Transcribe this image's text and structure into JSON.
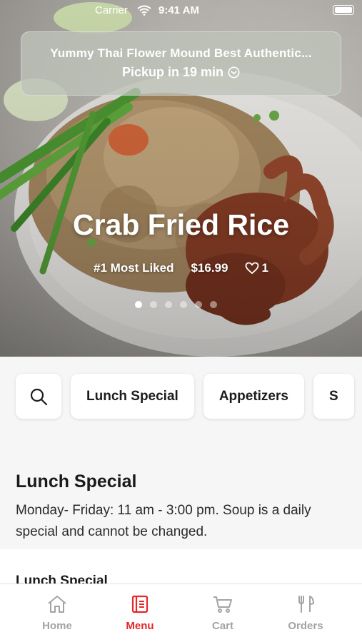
{
  "status_bar": {
    "carrier": "Carrier",
    "time": "9:41 AM"
  },
  "store": {
    "name": "Yummy Thai Flower Mound Best Authentic...",
    "pickup": "Pickup in 19 min"
  },
  "featured": {
    "title": "Crab Fried Rice",
    "rank": "#1 Most Liked",
    "price": "$16.99",
    "likes": "1",
    "carousel": {
      "count": 6,
      "active_index": 0
    }
  },
  "categories": [
    "Lunch Special",
    "Appetizers",
    "S"
  ],
  "section": {
    "title": "Lunch Special",
    "description": "Monday- Friday: 11 am - 3:00 pm. Soup is a daily special and cannot be changed.",
    "first_item_peek": "Lunch Special"
  },
  "tabs": [
    {
      "label": "Home",
      "icon": "home-icon",
      "active": false
    },
    {
      "label": "Menu",
      "icon": "menu-icon",
      "active": true
    },
    {
      "label": "Cart",
      "icon": "cart-icon",
      "active": false
    },
    {
      "label": "Orders",
      "icon": "utensils-icon",
      "active": false
    }
  ],
  "colors": {
    "accent": "#e5262a",
    "inactive_tab": "#a3a3a3"
  }
}
